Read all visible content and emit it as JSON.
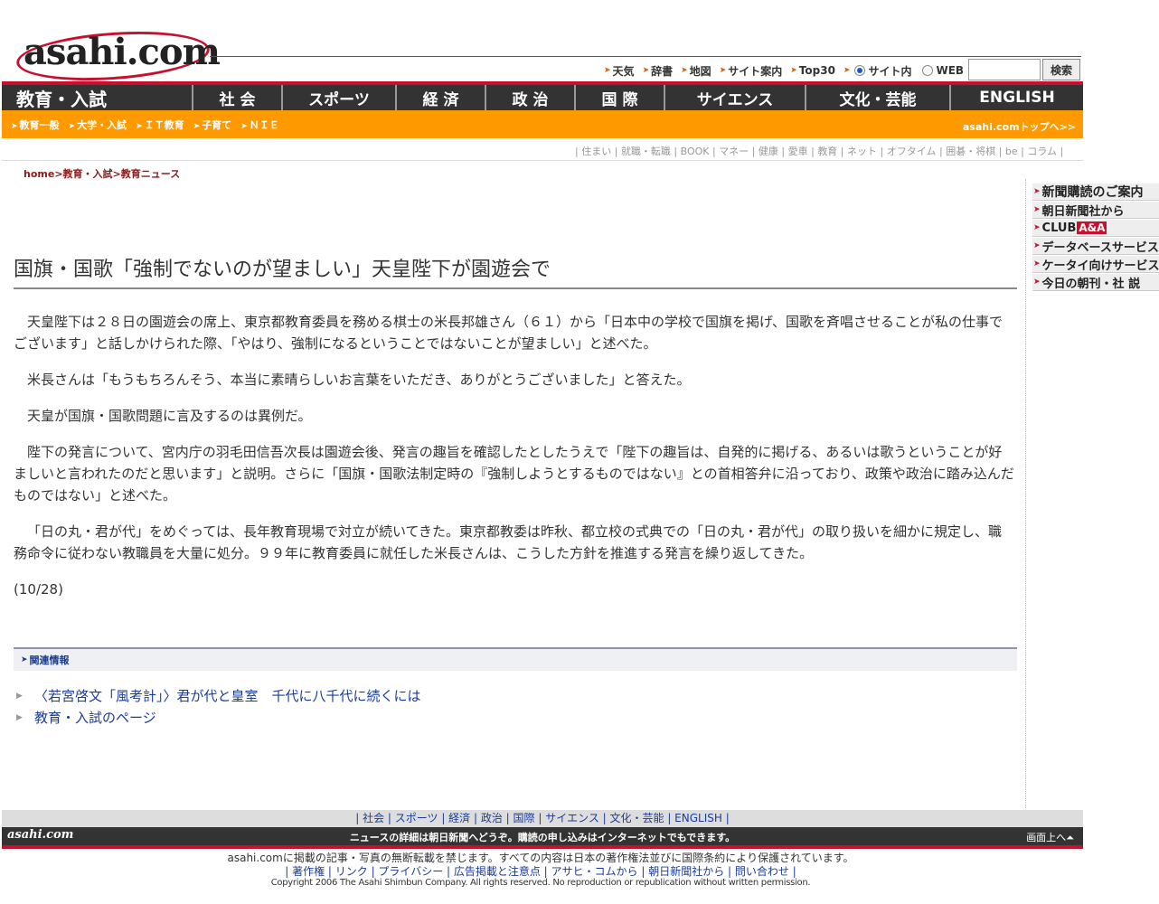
{
  "logo": {
    "text": "asahi.com"
  },
  "toplinks": [
    "天気",
    "辞書",
    "地図",
    "サイト案内",
    "Top30"
  ],
  "search": {
    "scope_site": "サイト内",
    "scope_web": "WEB",
    "button": "検索",
    "value": ""
  },
  "nav": {
    "active": "教育・入試",
    "items": [
      "社 会",
      "スポーツ",
      "経 済",
      "政 治",
      "国 際",
      "サイエンス",
      "文化・芸能",
      "ENGLISH"
    ]
  },
  "subnav": {
    "items": [
      "教育一般",
      "大学・入試",
      "ＩＴ教育",
      "子育て",
      "ＮＩＥ"
    ],
    "top_link": "asahi.comトップへ>>"
  },
  "section_links": [
    "住まい",
    "就職・転職",
    "BOOK",
    "マネー",
    "健康",
    "愛車",
    "教育",
    "ネット",
    "オフタイム",
    "囲碁・将棋",
    "be",
    "コラム"
  ],
  "breadcrumb": {
    "home": "home",
    "sep": ">",
    "level1": "教育・入試",
    "level2": "教育ニュース"
  },
  "sidebar": {
    "items": [
      "新聞購読のご案内",
      "朝日新聞社から",
      "データベースサービス",
      "ケータイ向けサービス",
      "今日の朝刊・社 説"
    ],
    "club_prefix": "CLUB",
    "club_badge": "A&A"
  },
  "article": {
    "headline": "国旗・国歌「強制でないのが望ましい」天皇陛下が園遊会で",
    "paragraphs": [
      "天皇陛下は２８日の園遊会の席上、東京都教育委員を務める棋士の米長邦雄さん（６１）から「日本中の学校で国旗を掲げ、国歌を斉唱させることが私の仕事でございます」と話しかけられた際、「やはり、強制になるということではないことが望ましい」と述べた。",
      "米長さんは「もうもちろんそう、本当に素晴らしいお言葉をいただき、ありがとうございました」と答えた。",
      "天皇が国旗・国歌問題に言及するのは異例だ。",
      "陛下の発言について、宮内庁の羽毛田信吾次長は園遊会後、発言の趣旨を確認したとしたうえで「陛下の趣旨は、自発的に掲げる、あるいは歌うということが好ましいと言われたのだと思います」と説明。さらに「国旗・国歌法制定時の『強制しようとするものではない』との首相答弁に沿っており、政策や政治に踏み込んだものではない」と述べた。",
      "「日の丸・君が代」をめぐっては、長年教育現場で対立が続いてきた。東京都教委は昨秋、都立校の式典での「日の丸・君が代」の取り扱いを細かに規定し、職務命令に従わない教職員を大量に処分。９９年に教育委員に就任した米長さんは、こうした方針を推進する発言を繰り返してきた。"
    ],
    "date": "(10/28)"
  },
  "related": {
    "title": "関連情報",
    "items": [
      "〈若宮啓文「風考計」〉君が代と皇室　千代に八千代に続くには",
      "教育・入試のページ"
    ]
  },
  "footer": {
    "links": "| 社会 | スポーツ | 経済 | 政治 | 国際 | サイエンス | 文化・芸能 | ENGLISH |",
    "logo": "asahi.com",
    "message": "ニュースの詳細は朝日新聞へどうぞ。購読の申し込みはインターネットでもできます。",
    "page_top": "画面上へ⏶",
    "notice": "asahi.comに掲載の記事・写真の無断転載を禁じます。すべての内容は日本の著作権法並びに国際条約により保護されています。",
    "bottom_links": "| 著作権 | リンク | プライバシー | 広告掲載と注意点 | アサヒ・コムから | 朝日新聞社から | 問い合わせ |",
    "copyright": "Copyright 2006 The Asahi Shimbun Company. All rights reserved. No reproduction or republication without written permission."
  },
  "colors": {
    "brand_red": "#c8102e",
    "nav_dark": "#333333",
    "accent_orange": "#ff9900",
    "link_blue": "#1a3c9c"
  }
}
